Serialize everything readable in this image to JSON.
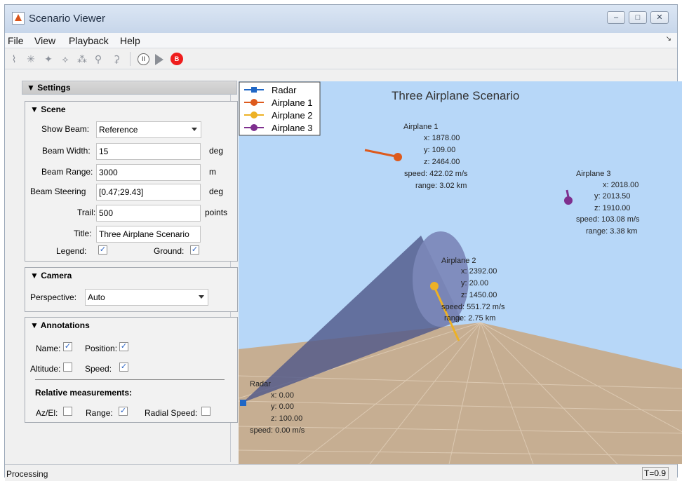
{
  "window": {
    "title": "Scenario Viewer",
    "controls": [
      "–",
      "□",
      "✕"
    ]
  },
  "menu": {
    "items": [
      "File",
      "View",
      "Playback",
      "Help"
    ],
    "arrow": "↘"
  },
  "toolbar": {
    "icons": [
      "view-icon-1",
      "view-icon-2",
      "view-icon-3",
      "view-icon-4",
      "view-icon-5",
      "view-icon-6",
      "view-icon-7"
    ],
    "pause_label": "II",
    "record_label": "B"
  },
  "settings": {
    "header": "▼ Settings",
    "scene": {
      "title": "▼ Scene",
      "show_beam_label": "Show Beam:",
      "show_beam_value": "Reference",
      "beam_width_label": "Beam Width:",
      "beam_width_value": "15",
      "beam_width_unit": "deg",
      "beam_range_label": "Beam Range:",
      "beam_range_value": "3000",
      "beam_range_unit": "m",
      "beam_steering_label": "Beam Steering",
      "beam_steering_value": "[0.47;29.43]",
      "beam_steering_unit": "deg",
      "trail_label": "Trail:",
      "trail_value": "500",
      "trail_unit": "points",
      "title_label": "Title:",
      "title_value": "Three Airplane Scenario",
      "legend_label": "Legend:",
      "legend_checked": true,
      "ground_label": "Ground:",
      "ground_checked": true
    },
    "camera": {
      "title": "▼ Camera",
      "perspective_label": "Perspective:",
      "perspective_value": "Auto"
    },
    "annotations": {
      "title": "▼ Annotations",
      "name_label": "Name:",
      "name_checked": true,
      "position_label": "Position:",
      "position_checked": true,
      "altitude_label": "Altitude:",
      "altitude_checked": false,
      "speed_label": "Speed:",
      "speed_checked": true,
      "relative_title": "Relative measurements:",
      "az_el_label": "Az/El:",
      "az_el_checked": false,
      "range_label": "Range:",
      "range_checked": true,
      "radial_speed_label": "Radial Speed:",
      "radial_speed_checked": false
    }
  },
  "viewer": {
    "title": "Three Airplane Scenario",
    "legend": [
      {
        "label": "Radar",
        "color": "#1f67c6",
        "marker": "square"
      },
      {
        "label": "Airplane 1",
        "color": "#dd5a1d",
        "marker": "circle"
      },
      {
        "label": "Airplane 2",
        "color": "#edb125",
        "marker": "circle"
      },
      {
        "label": "Airplane 3",
        "color": "#7e2f8e",
        "marker": "circle"
      }
    ],
    "airplane1": {
      "lines": [
        "Airplane 1",
        "x: 1878.00",
        "y: 109.00",
        "z: 2464.00",
        "speed: 422.02 m/s",
        "range: 3.02 km"
      ]
    },
    "airplane2": {
      "lines": [
        "Airplane 2",
        "x: 2392.00",
        "y: 20.00",
        "z: 1450.00",
        "speed: 551.72 m/s",
        "range: 2.75 km"
      ]
    },
    "airplane3": {
      "lines": [
        "Airplane 3",
        "x: 2018.00",
        "y: 2013.50",
        "z: 1910.00",
        "speed: 103.08 m/s",
        "range: 3.38 km"
      ]
    },
    "radar": {
      "lines": [
        "Radar",
        "x: 0.00",
        "y: 0.00",
        "z: 100.00",
        "speed: 0.00 m/s"
      ]
    }
  },
  "status": {
    "text": "Processing",
    "time": "T=0.9"
  }
}
